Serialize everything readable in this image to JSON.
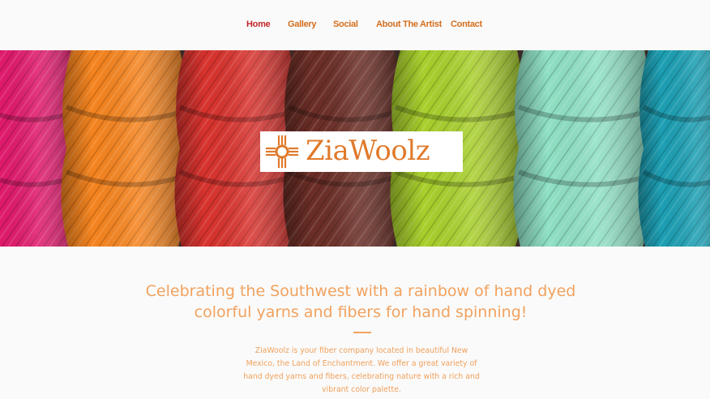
{
  "nav": {
    "items": [
      {
        "label": "Home",
        "active": true
      },
      {
        "label": "Gallery",
        "active": false
      },
      {
        "label": "Social",
        "active": false
      },
      {
        "label": "About The Artist",
        "active": false
      },
      {
        "label": "Contact",
        "active": false
      }
    ]
  },
  "hero": {
    "logo_text": "ZiaWoolz",
    "logo_icon": "zia-sun-icon",
    "yarn_colors": [
      "#e01a6c",
      "#f5841f",
      "#d8332e",
      "#6b2e26",
      "#a8cf2c",
      "#8fe0c4",
      "#1d9fb3"
    ]
  },
  "content": {
    "headline_line1": "Celebrating the Southwest with a rainbow of hand dyed",
    "headline_line2": "colorful yarns and fibers for hand spinning!",
    "body_line1": "ZiaWoolz is your fiber company located in beautiful New",
    "body_line2": "Mexico, the Land of Enchantment.  We offer a great variety of",
    "body_line3": "hand dyed yarns and fibers, celebrating nature with a rich and",
    "body_line4": "vibrant color palette."
  },
  "colors": {
    "nav_active": "#c2262a",
    "nav": "#d36e1d",
    "accent": "#f2a25e"
  }
}
